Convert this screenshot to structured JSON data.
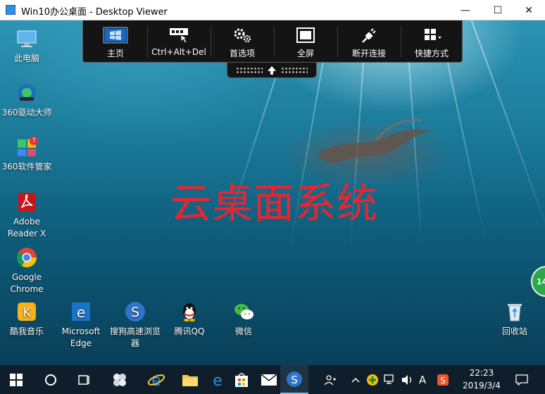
{
  "window": {
    "title": "Win10办公桌面 - Desktop Viewer",
    "minimize": "—",
    "maximize": "☐",
    "close": "✕"
  },
  "toolbar": {
    "items": [
      {
        "label": "主页",
        "icon": "windows-home-icon"
      },
      {
        "label": "Ctrl+Alt+Del",
        "icon": "keyboard-icon"
      },
      {
        "label": "首选项",
        "icon": "gears-icon"
      },
      {
        "label": "全屏",
        "icon": "fullscreen-icon"
      },
      {
        "label": "断开连接",
        "icon": "disconnect-plug-icon"
      },
      {
        "label": "快捷方式",
        "icon": "shortcuts-grid-icon"
      }
    ],
    "pull_tab_icon": "arrow-up-icon"
  },
  "watermark": "云桌面系统",
  "desktop_icons": [
    {
      "label": "此电脑",
      "icon": "computer-icon"
    },
    {
      "label": "360驱动大师",
      "icon": "360-driver-icon"
    },
    {
      "label": "360软件管家",
      "icon": "360-software-icon",
      "badge": "7"
    },
    {
      "label": "Adobe Reader X",
      "icon": "adobe-reader-icon"
    },
    {
      "label": "Google Chrome",
      "icon": "chrome-icon"
    },
    {
      "label": "酷我音乐",
      "icon": "kuwo-music-icon"
    },
    {
      "label": "Microsoft Edge",
      "icon": "edge-icon"
    },
    {
      "label": "搜狗高速浏览器",
      "icon": "sogou-browser-icon"
    },
    {
      "label": "腾讯QQ",
      "icon": "qq-icon"
    },
    {
      "label": "微信",
      "icon": "wechat-icon"
    },
    {
      "label": "回收站",
      "icon": "recycle-bin-icon"
    }
  ],
  "float_ball": "14",
  "taskbar": {
    "apps": [
      "start-icon",
      "cortana-icon",
      "task-view-icon",
      "app-flower-icon",
      "ie-icon",
      "file-explorer-icon",
      "edge-icon",
      "store-icon",
      "mail-icon",
      "sogou-browser-icon"
    ],
    "tray": {
      "input_method": "A",
      "clock_time": "22:23",
      "clock_date": "2019/3/4"
    }
  },
  "colors": {
    "watermark": "#e82530",
    "toolbar_bg": "#141414",
    "taskbar_bg": "#0f1e2a"
  }
}
